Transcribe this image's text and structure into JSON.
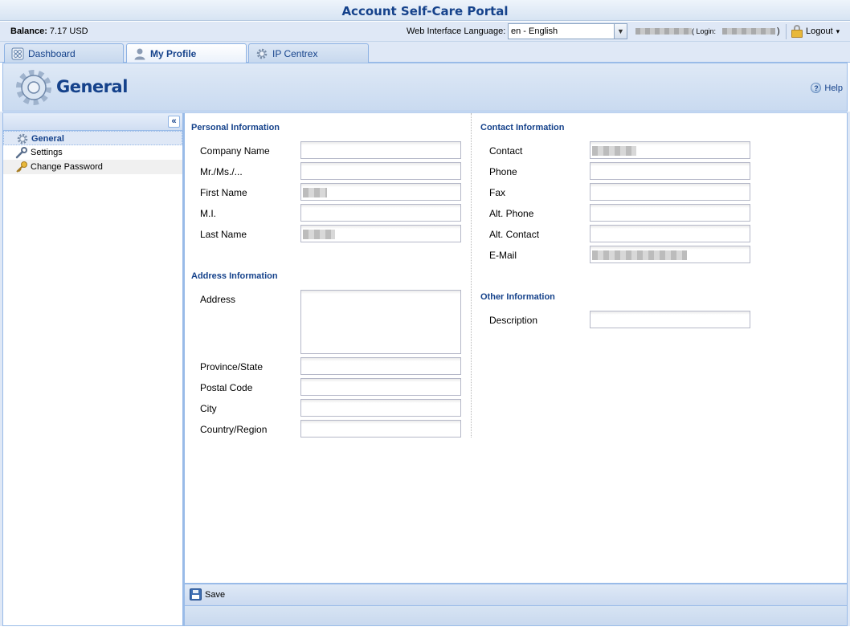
{
  "app": {
    "title": "Account Self-Care Portal"
  },
  "topbar": {
    "balance_label": "Balance:",
    "balance_value": "7.17 USD",
    "language_label": "Web Interface Language:",
    "language_value": "en - English",
    "login_prefix": "( Login:",
    "login_suffix": ")",
    "logout_label": "Logout",
    "logout_arrow": "▾"
  },
  "tabs": [
    {
      "label": "Dashboard",
      "icon": "dashboard-icon",
      "active": false
    },
    {
      "label": "My Profile",
      "icon": "user-icon",
      "active": true
    },
    {
      "label": "IP Centrex",
      "icon": "gear-icon",
      "active": false
    }
  ],
  "header": {
    "title": "General",
    "help_label": "Help"
  },
  "sidebar": {
    "collapse_glyph": "«",
    "items": [
      {
        "label": "General",
        "icon": "gear-icon",
        "selected": true
      },
      {
        "label": "Settings",
        "icon": "wrench-icon",
        "selected": false
      },
      {
        "label": "Change Password",
        "icon": "key-icon",
        "selected": false
      }
    ]
  },
  "form": {
    "personal": {
      "title": "Personal Information",
      "company_name": "Company Name",
      "salutation": "Mr./Ms./...",
      "first_name": "First Name",
      "mi": "M.I.",
      "last_name": "Last Name"
    },
    "address": {
      "title": "Address Information",
      "address": "Address",
      "province": "Province/State",
      "postal": "Postal Code",
      "city": "City",
      "country": "Country/Region"
    },
    "contact": {
      "title": "Contact Information",
      "contact": "Contact",
      "phone": "Phone",
      "fax": "Fax",
      "alt_phone": "Alt. Phone",
      "alt_contact": "Alt. Contact",
      "email": "E-Mail"
    },
    "other": {
      "title": "Other Information",
      "description": "Description"
    }
  },
  "footer": {
    "save_label": "Save"
  },
  "colors": {
    "accent": "#15428b",
    "border": "#99bbe8",
    "panel": "#dfe8f6"
  }
}
